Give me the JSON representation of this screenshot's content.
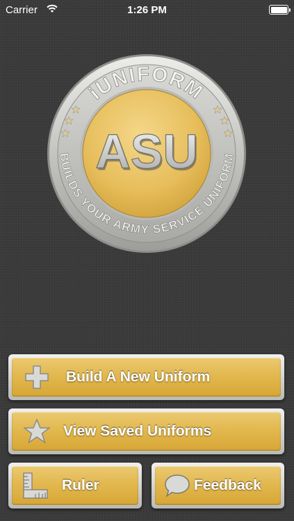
{
  "status_bar": {
    "carrier": "Carrier",
    "time": "1:26 PM"
  },
  "emblem": {
    "top_text": "iUNIFORM",
    "center_text": "ASU",
    "ring_text": "BUILDS YOUR ARMY SERVICE UNIFORM"
  },
  "buttons": {
    "build": "Build A New Uniform",
    "view": "View Saved Uniforms",
    "ruler": "Ruler",
    "feedback": "Feedback"
  },
  "colors": {
    "background": "#3a3a3a",
    "gold": "#e2b84f",
    "silver": "#c8c8c6"
  }
}
